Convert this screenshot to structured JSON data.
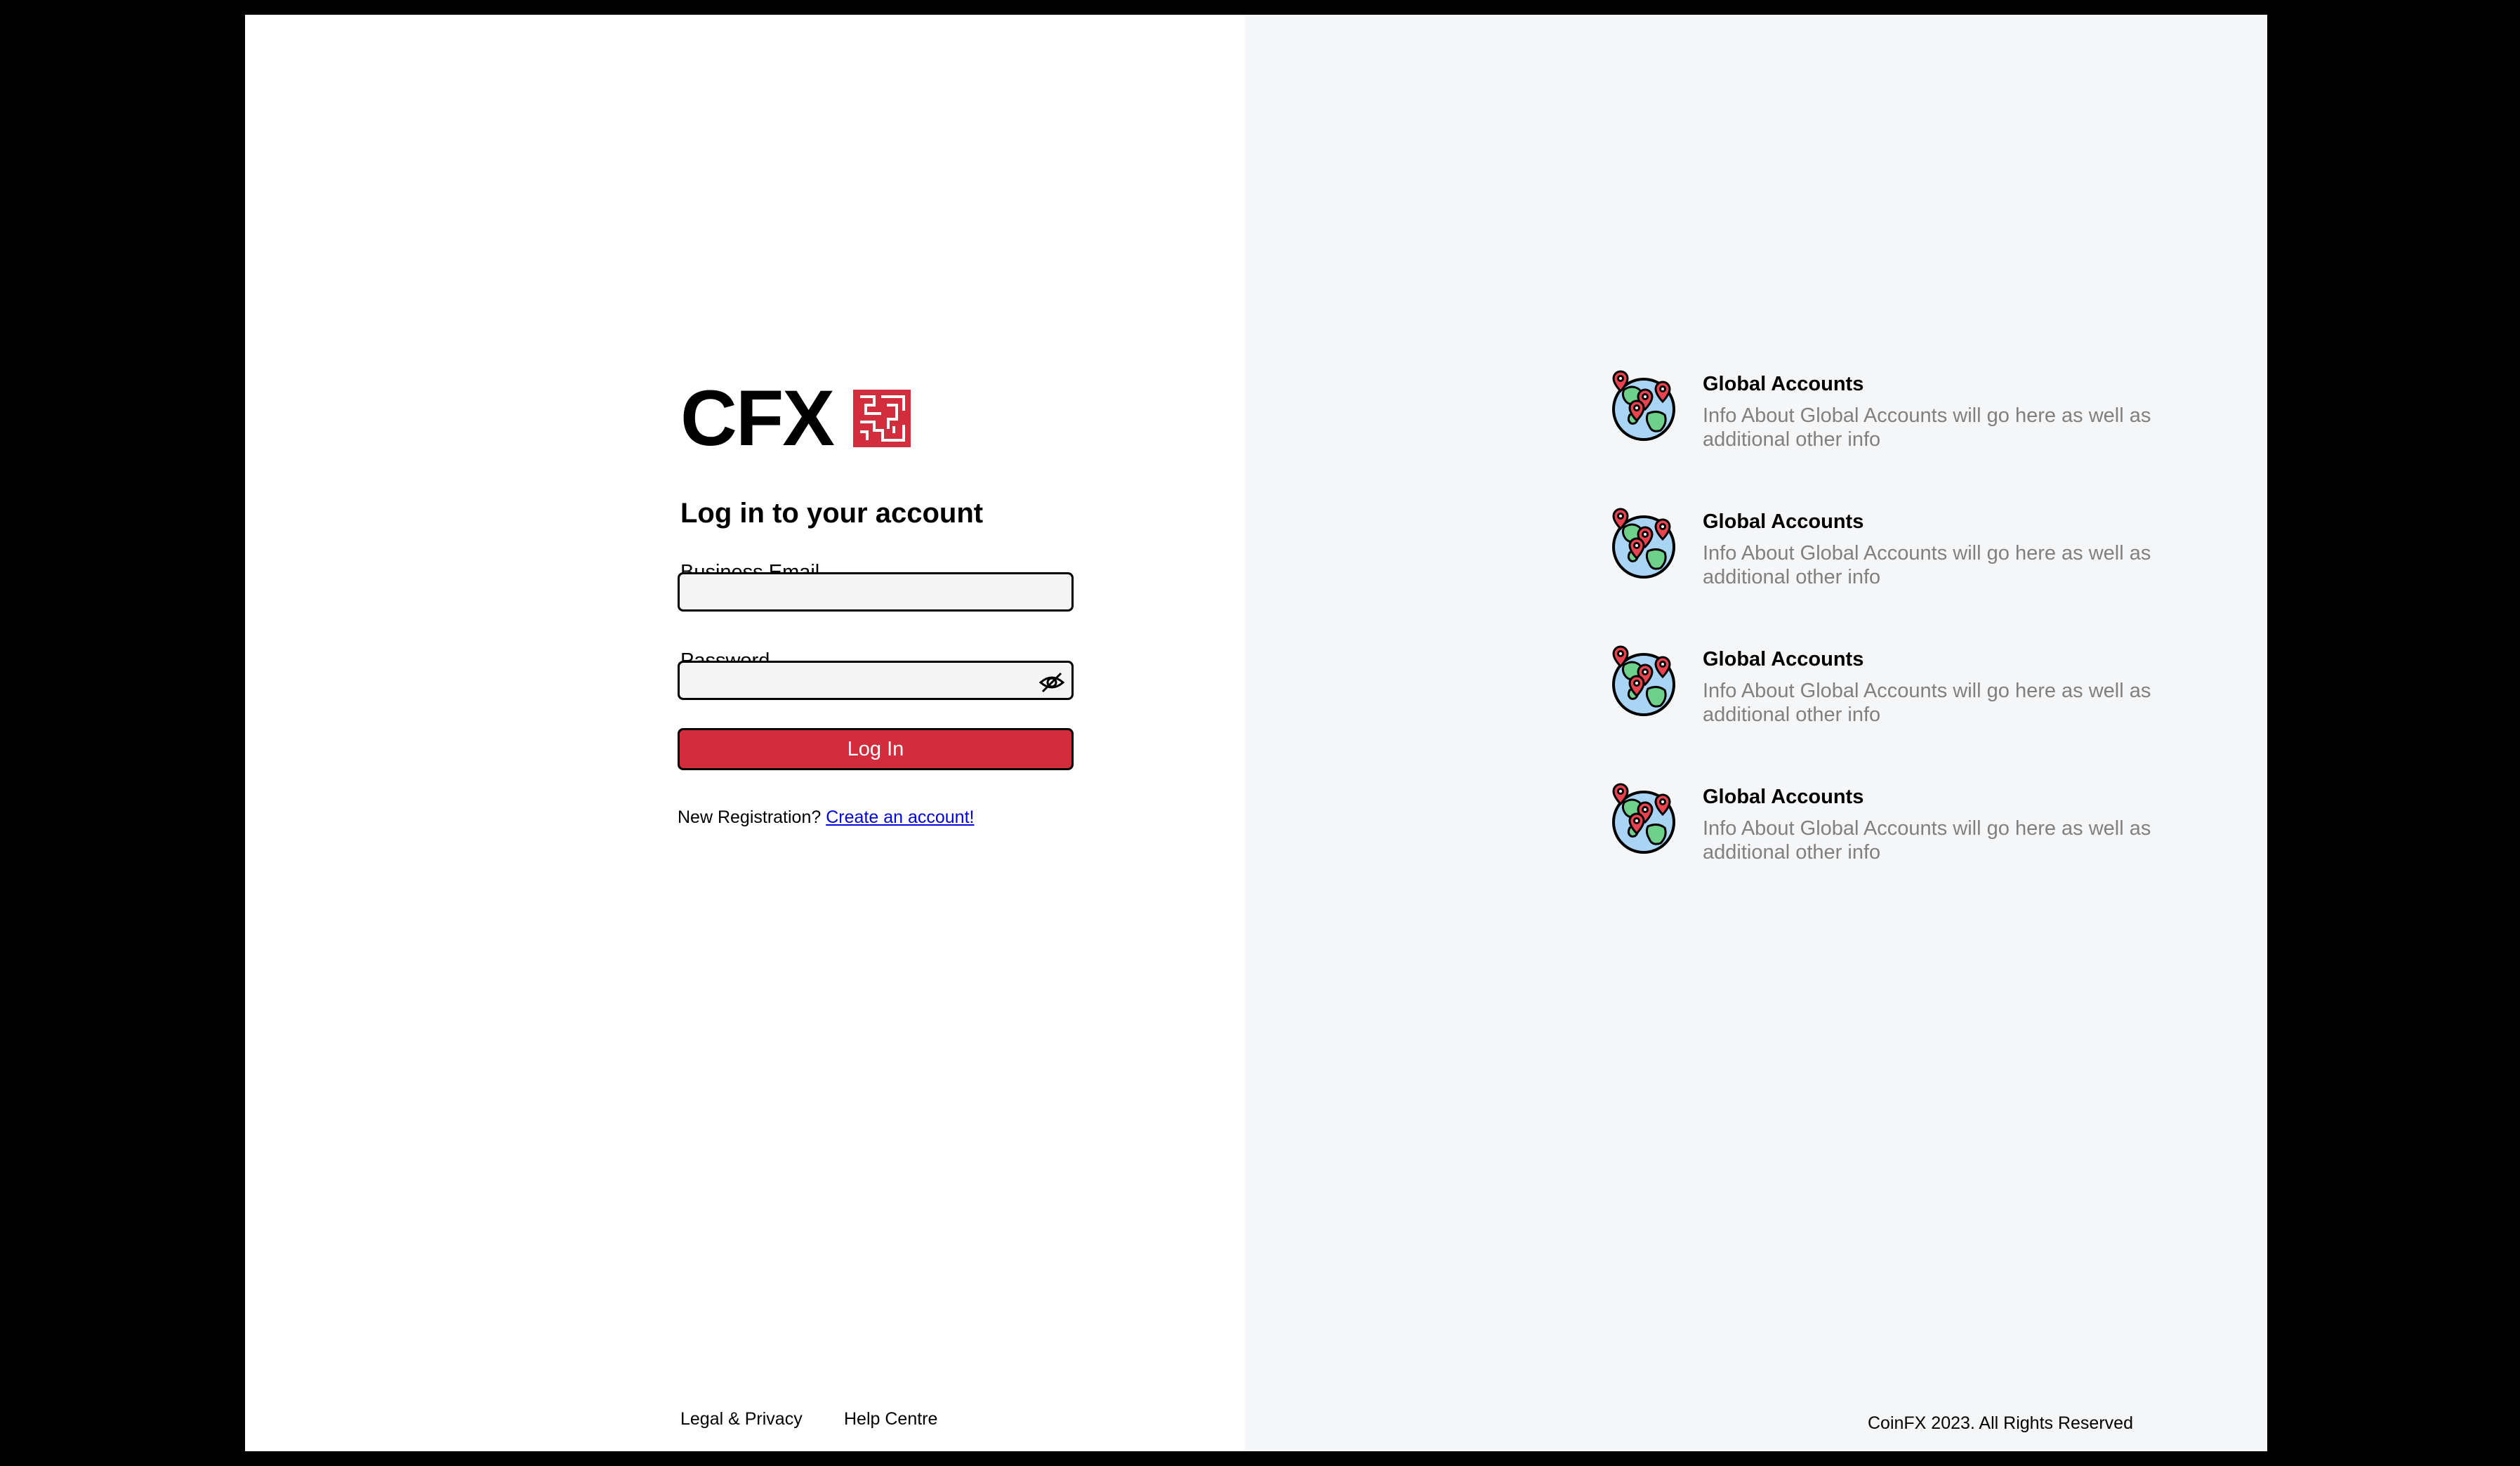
{
  "brand": {
    "name": "CFX",
    "accent_color": "#d22d3c"
  },
  "login": {
    "title": "Log in to your account",
    "email_label": "Business Email",
    "email_value": "",
    "password_label": "Password",
    "password_value": "",
    "password_toggle_icon": "eye-off-icon",
    "submit_label": "Log In",
    "register_prompt": "New Registration?",
    "register_link": "Create an account!"
  },
  "footer": {
    "links": [
      "Legal & Privacy",
      "Help Centre"
    ],
    "copyright": "CoinFX 2023. All Rights Reserved"
  },
  "features": [
    {
      "icon": "globe-pins-icon",
      "title": "Global Accounts",
      "description": "Info About Global Accounts will go here as well as additional other info"
    },
    {
      "icon": "globe-pins-icon",
      "title": "Global Accounts",
      "description": "Info About Global Accounts will go here as well as additional other info"
    },
    {
      "icon": "globe-pins-icon",
      "title": "Global Accounts",
      "description": "Info About Global Accounts will go here as well as additional other info"
    },
    {
      "icon": "globe-pins-icon",
      "title": "Global Accounts",
      "description": "Info About Global Accounts will go here as well as additional other info"
    }
  ]
}
